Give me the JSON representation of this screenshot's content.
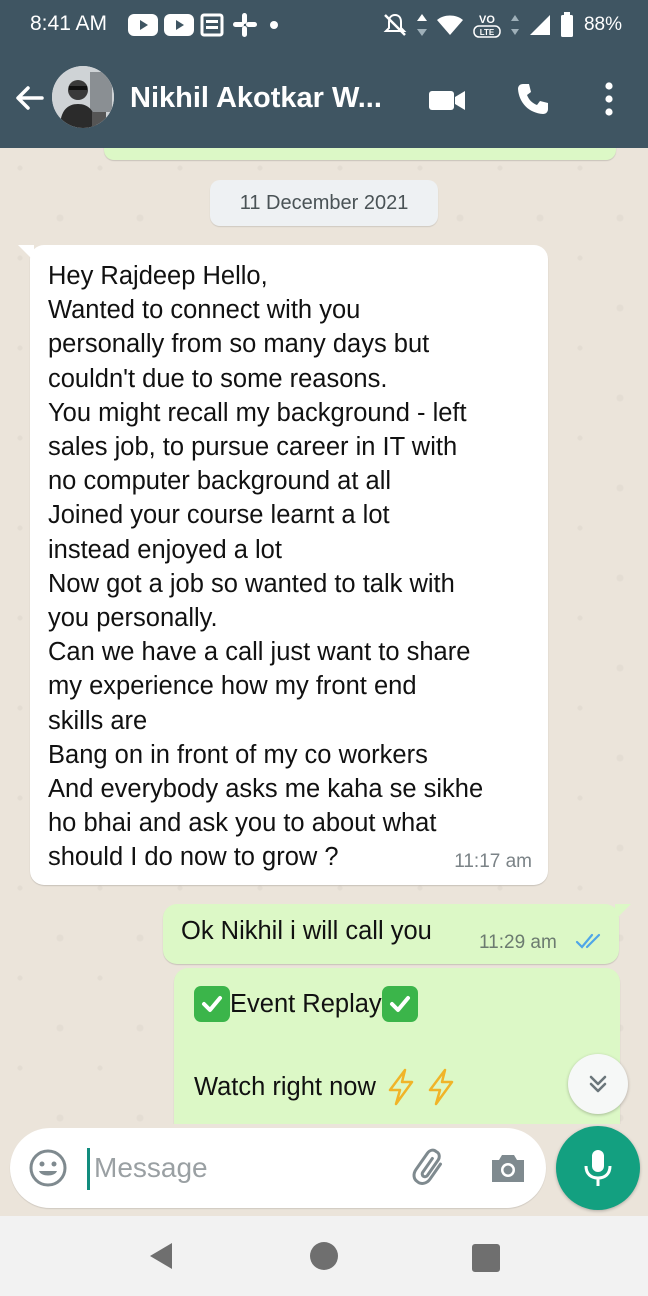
{
  "status_bar": {
    "time": "8:41 AM",
    "battery": "88%",
    "left_icons": [
      "youtube-icon",
      "youtube-icon",
      "news-icon",
      "slack-icon",
      "dot-icon"
    ],
    "right_icons": [
      "mute-icon",
      "data-arrows-icon",
      "wifi-icon",
      "volte-icon",
      "signal-icon",
      "battery-icon"
    ]
  },
  "header": {
    "contact_name": "Nikhil Akotkar W...",
    "icons": [
      "back-arrow-icon",
      "video-call-icon",
      "phone-icon",
      "more-vert-icon"
    ]
  },
  "chat": {
    "date_label": "11 December 2021",
    "messages": [
      {
        "direction": "incoming",
        "text": "Hey Rajdeep Hello,\nWanted to connect with you\npersonally from so many days but\ncouldn't due to some reasons.\nYou might recall my background - left\nsales job, to pursue career in IT with\nno computer background at all\nJoined your course learnt a lot\ninstead enjoyed a lot\nNow got a job so wanted to talk with\nyou personally.\nCan we have a call just want to share\nmy experience how my front end\nskills are\nBang on in front of my co workers\nAnd everybody asks me kaha se sikhe\nho bhai  and ask you to about what\nshould I do now to grow ?",
        "time": "11:17 am"
      },
      {
        "direction": "outgoing",
        "text": "Ok Nikhil i will call you",
        "time": "11:29 am",
        "status": "read"
      },
      {
        "direction": "outgoing",
        "title": "Event Replay",
        "body": "Watch right now",
        "emojis": [
          "check-mark-button-icon",
          "high-voltage-icon"
        ]
      }
    ]
  },
  "composer": {
    "placeholder": "Message",
    "value": "",
    "icons": [
      "emoji-icon",
      "attach-icon",
      "camera-icon",
      "mic-icon"
    ]
  },
  "colors": {
    "header_bg": "#3f5562",
    "outgoing_bubble": "#dcf8c6",
    "incoming_bubble": "#ffffff",
    "accent": "#13a080",
    "read_ticks": "#4fa6e8"
  }
}
